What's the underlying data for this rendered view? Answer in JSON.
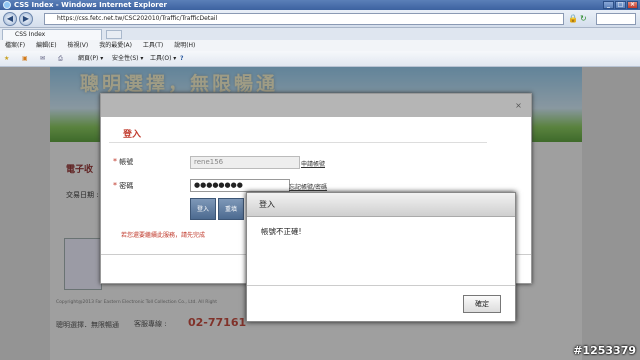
{
  "window": {
    "title": "CSS Index - Windows Internet Explorer"
  },
  "address": {
    "url": "https://css.fetc.net.tw/CSC202010/Traffic/TrafficDetail"
  },
  "tab": {
    "label": "CSS Index"
  },
  "menu": [
    "檔案(F)",
    "編輯(E)",
    "檢視(V)",
    "我的最愛(A)",
    "工具(T)",
    "說明(H)"
  ],
  "commandbar": {
    "page": "網頁(P) ▾",
    "safety": "安全性(S) ▾",
    "tools": "工具(O) ▾",
    "help": "?"
  },
  "page": {
    "banner_text": "聰明選擇，無限暢通",
    "content_title": "電子收",
    "date_label": "交易日期 :",
    "footer_copyright": "Copyright@2013 Far Eastern Electronic Toll Collection Co., Ltd. All Right",
    "footer_slogan": "聰明選擇．無限暢通",
    "footer_service": "客服專線 :",
    "footer_phone": "02-77161"
  },
  "login": {
    "title": "登入",
    "account_label": "帳號",
    "account_value": "rene156",
    "apply_link": "申請帳號",
    "password_label": "密碼",
    "password_value": "●●●●●●●●",
    "forgot_link": "忘記帳號/密碼",
    "login_button": "登入",
    "reset_button": "重填",
    "note": "若您還要繼續此服務，請先完成"
  },
  "alert": {
    "title": "登入",
    "message": "帳號不正確!",
    "ok_button": "確定"
  },
  "watermark": "#1253379"
}
